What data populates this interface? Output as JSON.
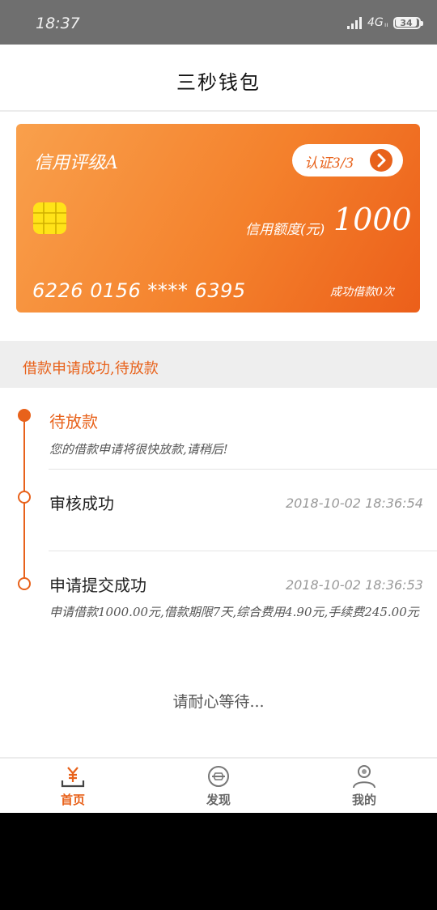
{
  "status_bar": {
    "time": "18:37",
    "network": "4G",
    "network_mini": "ıı",
    "battery": "34"
  },
  "header": {
    "title": "三秒钱包"
  },
  "card": {
    "credit_rating": "信用评级A",
    "verify_label": "认证3/3",
    "limit_label": "信用额度(元)",
    "limit_value": "1000",
    "card_number": "6226 0156 **** 6395",
    "loan_count": "成功借款0次",
    "colors": {
      "start": "#f9a04c",
      "end": "#ec5f1a",
      "accent": "#e8621b"
    }
  },
  "status": {
    "header": "借款申请成功,待放款"
  },
  "timeline": [
    {
      "title": "待放款",
      "desc": "您的借款申请将很快放款,请稍后!",
      "time": ""
    },
    {
      "title": "审核成功",
      "desc": "",
      "time": "2018-10-02 18:36:54"
    },
    {
      "title": "申请提交成功",
      "desc": "申请借款1000.00元,借款期限7天,综合费用4.90元,手续费245.00元",
      "time": "2018-10-02 18:36:53"
    }
  ],
  "wait_text": "请耐心等待...",
  "tabs": [
    {
      "label": "首页",
      "icon": "yen-wallet-icon",
      "active": true
    },
    {
      "label": "发现",
      "icon": "discover-icon",
      "active": false
    },
    {
      "label": "我的",
      "icon": "user-icon",
      "active": false
    }
  ]
}
